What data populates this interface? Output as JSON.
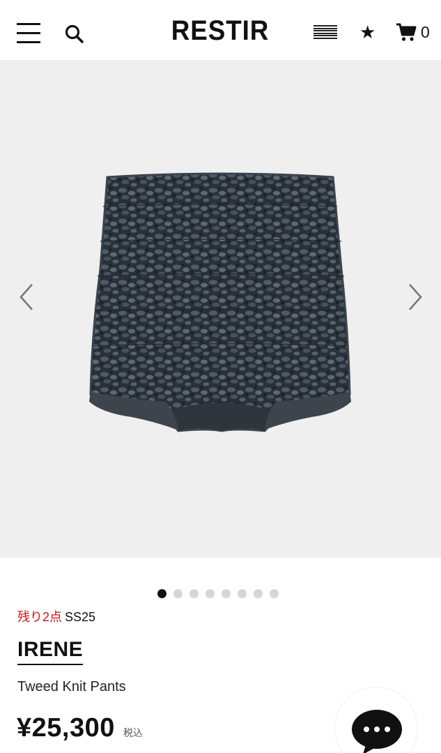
{
  "header": {
    "logo": "RESTIR",
    "cart_count": "0"
  },
  "icons": {
    "menu": "hamburger-icon",
    "search": "search-icon",
    "flag": "us-flag-icon",
    "favorites": "star-icon",
    "cart": "cart-icon",
    "prev": "chevron-left-icon",
    "next": "chevron-right-icon",
    "chat": "chat-bubble-icon"
  },
  "gallery": {
    "slide_count": 8,
    "active_slide": 1
  },
  "product": {
    "stock_note": "残り2点",
    "season": "SS25",
    "brand": "IRENE",
    "name": "Tweed Knit Pants",
    "price": "¥25,300",
    "tax_note": "税込"
  },
  "colors": {
    "accent_red": "#c0171c",
    "gallery_bg": "#efefef",
    "dot_active": "#111111",
    "dot_inactive": "#d6d6d6"
  }
}
